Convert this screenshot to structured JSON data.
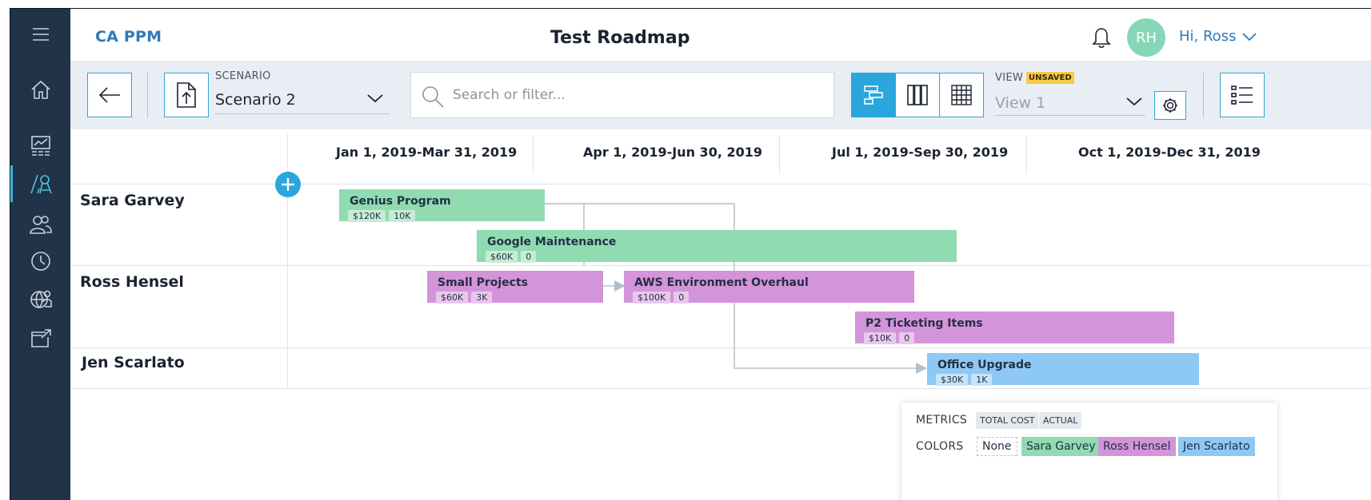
{
  "header": {
    "brand": "CA PPM",
    "title": "Test Roadmap",
    "avatar_initials": "RH",
    "greeting": "Hi, Ross"
  },
  "sidebar": {
    "items": [
      {
        "icon": "menu-icon"
      },
      {
        "icon": "home-icon"
      },
      {
        "icon": "dashboard-chart-icon"
      },
      {
        "icon": "roadmap-icon",
        "active": true
      },
      {
        "icon": "people-icon"
      },
      {
        "icon": "clock-icon"
      },
      {
        "icon": "globe-user-icon"
      },
      {
        "icon": "external-link-icon"
      }
    ]
  },
  "toolbar": {
    "scenario_label": "SCENARIO",
    "scenario_value": "Scenario 2",
    "search_placeholder": "Search or filter...",
    "view_label": "VIEW",
    "view_badge": "UNSAVED",
    "view_value": "View 1"
  },
  "timeline": {
    "quarters": [
      "Jan 1, 2019-Mar 31, 2019",
      "Apr 1, 2019-Jun 30, 2019",
      "Jul 1, 2019-Sep 30, 2019",
      "Oct 1, 2019-Dec 31, 2019"
    ],
    "owners": [
      "Sara Garvey",
      "Ross Hensel",
      "Jen Scarlato"
    ],
    "items": [
      {
        "title": "Genius Program",
        "cost": "$120K",
        "actual": "10K",
        "color": "#90dbb1",
        "owner": "Sara Garvey"
      },
      {
        "title": "Google Maintenance",
        "cost": "$60K",
        "actual": "0",
        "color": "#90dbb1",
        "owner": "Sara Garvey"
      },
      {
        "title": "Small Projects",
        "cost": "$60K",
        "actual": "3K",
        "color": "#d394d9",
        "owner": "Ross Hensel"
      },
      {
        "title": "AWS Environment Overhaul",
        "cost": "$100K",
        "actual": "0",
        "color": "#d394d9",
        "owner": "Ross Hensel"
      },
      {
        "title": "P2 Ticketing Items",
        "cost": "$10K",
        "actual": "0",
        "color": "#d394d9",
        "owner": "Ross Hensel"
      },
      {
        "title": "Office Upgrade",
        "cost": "$30K",
        "actual": "1K",
        "color": "#8ec9f4",
        "owner": "Jen Scarlato"
      }
    ]
  },
  "legend": {
    "metrics_label": "METRICS",
    "metrics": [
      "TOTAL COST",
      "ACTUAL"
    ],
    "colors_label": "COLORS",
    "colors": [
      {
        "label": "None",
        "color": "#ffffff"
      },
      {
        "label": "Sara Garvey",
        "color": "#90dbb1"
      },
      {
        "label": "Ross Hensel",
        "color": "#d394d9"
      },
      {
        "label": "Jen Scarlato",
        "color": "#8ec9f4"
      }
    ]
  },
  "accent_color": "#2aa6dc",
  "sidebar_color": "#213348"
}
